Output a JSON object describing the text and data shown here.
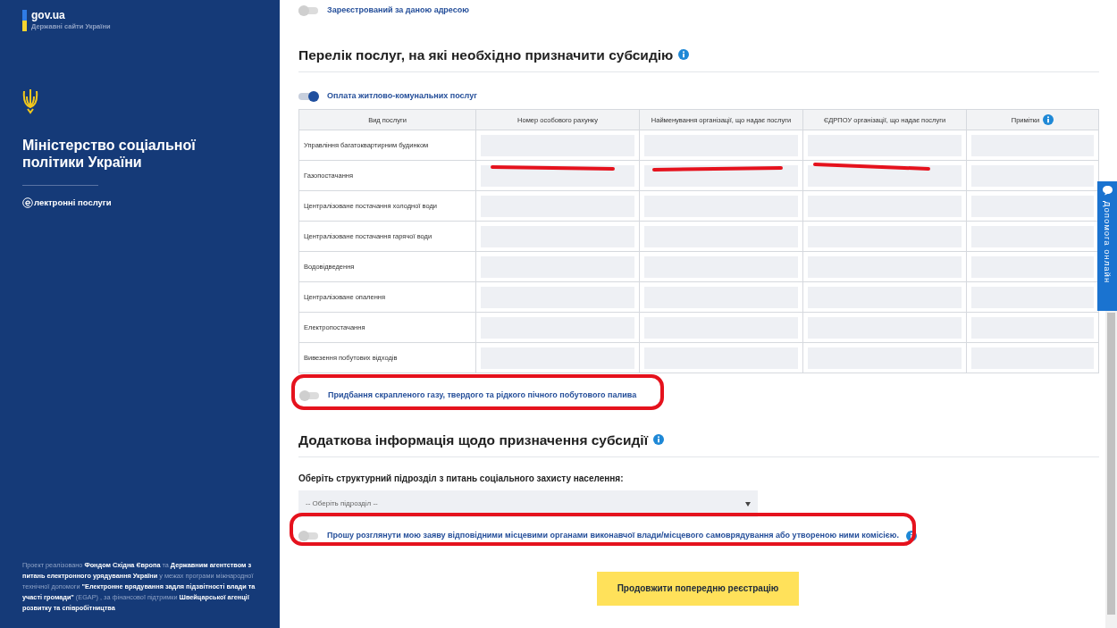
{
  "sidebar": {
    "logo": {
      "title": "gov.ua",
      "subtitle": "Державні сайти України"
    },
    "ministry": "Міністерство соціальної політики України",
    "service_link": "лектронні послуги",
    "footer": "Проект реалізовано **Фондом Східна Європа** та **Державним агентством з питань електронного урядування України** у межах програми міжнародної технічної допомоги **\"Електронне врядування задля підзвітності влади та участі громади\"** (EGAP) , за фінансової підтримки **Швейцарської агенції розвитку та співробітництва**"
  },
  "main": {
    "registered_toggle": {
      "label": "Зареєстрований за даною адресою",
      "on": false,
      "info": false
    },
    "services_section": {
      "title": "Перелік послуг, на які необхідно призначити субсидію",
      "utilities_toggle": {
        "label": "Оплата житлово-комунальних послуг",
        "on": true,
        "info": false
      },
      "table": {
        "columns": [
          {
            "label": "Вид послуги",
            "info": false
          },
          {
            "label": "Номер особового рахунку",
            "info": false
          },
          {
            "label": "Найменування організації, що надає послуги",
            "info": false
          },
          {
            "label": "ЄДРПОУ організації, що надає послуги",
            "info": false
          },
          {
            "label": "Примітки",
            "info": true
          }
        ],
        "rows": [
          {
            "service": "Управління багатоквартирним будинком"
          },
          {
            "service": "Газопостачання"
          },
          {
            "service": "Централізоване постачання холодної води"
          },
          {
            "service": "Централізоване постачання гарячої води"
          },
          {
            "service": "Водовідведення"
          },
          {
            "service": "Централізоване опалення"
          },
          {
            "service": "Електропостачання"
          },
          {
            "service": "Вивезення побутових відходів"
          }
        ]
      },
      "fuel_toggle": {
        "label": "Придбання скрапленого газу, твердого та рідкого пічного побутового палива",
        "on": false,
        "info": false
      }
    },
    "additional_section": {
      "title": "Додаткова інформація щодо призначення субсидії",
      "select_label": "Оберіть структурний підрозділ з питань соціального захисту населення:",
      "select": {
        "value": "-- Оберіть підрозділ --"
      },
      "review_toggle": {
        "label": "Прошу розглянути мою заяву відповідними місцевими органами виконавчої влади/місцевого самоврядування або утвореною ними комісією.",
        "on": false,
        "info": true
      }
    },
    "submit_button": "Продовжити попередню реєстрацію"
  },
  "help_tab": {
    "label": "Допомога онлайн"
  }
}
